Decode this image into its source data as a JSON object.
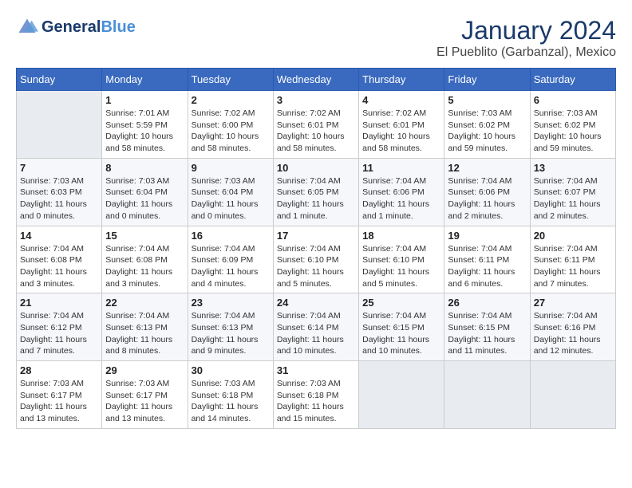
{
  "header": {
    "logo_line1": "General",
    "logo_line2": "Blue",
    "month_title": "January 2024",
    "location": "El Pueblito (Garbanzal), Mexico"
  },
  "calendar": {
    "days_of_week": [
      "Sunday",
      "Monday",
      "Tuesday",
      "Wednesday",
      "Thursday",
      "Friday",
      "Saturday"
    ],
    "weeks": [
      [
        {
          "day": "",
          "empty": true
        },
        {
          "day": "1",
          "sunrise": "7:01 AM",
          "sunset": "5:59 PM",
          "daylight": "10 hours and 58 minutes."
        },
        {
          "day": "2",
          "sunrise": "7:02 AM",
          "sunset": "6:00 PM",
          "daylight": "10 hours and 58 minutes."
        },
        {
          "day": "3",
          "sunrise": "7:02 AM",
          "sunset": "6:01 PM",
          "daylight": "10 hours and 58 minutes."
        },
        {
          "day": "4",
          "sunrise": "7:02 AM",
          "sunset": "6:01 PM",
          "daylight": "10 hours and 58 minutes."
        },
        {
          "day": "5",
          "sunrise": "7:03 AM",
          "sunset": "6:02 PM",
          "daylight": "10 hours and 59 minutes."
        },
        {
          "day": "6",
          "sunrise": "7:03 AM",
          "sunset": "6:02 PM",
          "daylight": "10 hours and 59 minutes."
        }
      ],
      [
        {
          "day": "7",
          "sunrise": "7:03 AM",
          "sunset": "6:03 PM",
          "daylight": "11 hours and 0 minutes."
        },
        {
          "day": "8",
          "sunrise": "7:03 AM",
          "sunset": "6:04 PM",
          "daylight": "11 hours and 0 minutes."
        },
        {
          "day": "9",
          "sunrise": "7:03 AM",
          "sunset": "6:04 PM",
          "daylight": "11 hours and 0 minutes."
        },
        {
          "day": "10",
          "sunrise": "7:04 AM",
          "sunset": "6:05 PM",
          "daylight": "11 hours and 1 minute."
        },
        {
          "day": "11",
          "sunrise": "7:04 AM",
          "sunset": "6:06 PM",
          "daylight": "11 hours and 1 minute."
        },
        {
          "day": "12",
          "sunrise": "7:04 AM",
          "sunset": "6:06 PM",
          "daylight": "11 hours and 2 minutes."
        },
        {
          "day": "13",
          "sunrise": "7:04 AM",
          "sunset": "6:07 PM",
          "daylight": "11 hours and 2 minutes."
        }
      ],
      [
        {
          "day": "14",
          "sunrise": "7:04 AM",
          "sunset": "6:08 PM",
          "daylight": "11 hours and 3 minutes."
        },
        {
          "day": "15",
          "sunrise": "7:04 AM",
          "sunset": "6:08 PM",
          "daylight": "11 hours and 3 minutes."
        },
        {
          "day": "16",
          "sunrise": "7:04 AM",
          "sunset": "6:09 PM",
          "daylight": "11 hours and 4 minutes."
        },
        {
          "day": "17",
          "sunrise": "7:04 AM",
          "sunset": "6:10 PM",
          "daylight": "11 hours and 5 minutes."
        },
        {
          "day": "18",
          "sunrise": "7:04 AM",
          "sunset": "6:10 PM",
          "daylight": "11 hours and 5 minutes."
        },
        {
          "day": "19",
          "sunrise": "7:04 AM",
          "sunset": "6:11 PM",
          "daylight": "11 hours and 6 minutes."
        },
        {
          "day": "20",
          "sunrise": "7:04 AM",
          "sunset": "6:11 PM",
          "daylight": "11 hours and 7 minutes."
        }
      ],
      [
        {
          "day": "21",
          "sunrise": "7:04 AM",
          "sunset": "6:12 PM",
          "daylight": "11 hours and 7 minutes."
        },
        {
          "day": "22",
          "sunrise": "7:04 AM",
          "sunset": "6:13 PM",
          "daylight": "11 hours and 8 minutes."
        },
        {
          "day": "23",
          "sunrise": "7:04 AM",
          "sunset": "6:13 PM",
          "daylight": "11 hours and 9 minutes."
        },
        {
          "day": "24",
          "sunrise": "7:04 AM",
          "sunset": "6:14 PM",
          "daylight": "11 hours and 10 minutes."
        },
        {
          "day": "25",
          "sunrise": "7:04 AM",
          "sunset": "6:15 PM",
          "daylight": "11 hours and 10 minutes."
        },
        {
          "day": "26",
          "sunrise": "7:04 AM",
          "sunset": "6:15 PM",
          "daylight": "11 hours and 11 minutes."
        },
        {
          "day": "27",
          "sunrise": "7:04 AM",
          "sunset": "6:16 PM",
          "daylight": "11 hours and 12 minutes."
        }
      ],
      [
        {
          "day": "28",
          "sunrise": "7:03 AM",
          "sunset": "6:17 PM",
          "daylight": "11 hours and 13 minutes."
        },
        {
          "day": "29",
          "sunrise": "7:03 AM",
          "sunset": "6:17 PM",
          "daylight": "11 hours and 13 minutes."
        },
        {
          "day": "30",
          "sunrise": "7:03 AM",
          "sunset": "6:18 PM",
          "daylight": "11 hours and 14 minutes."
        },
        {
          "day": "31",
          "sunrise": "7:03 AM",
          "sunset": "6:18 PM",
          "daylight": "11 hours and 15 minutes."
        },
        {
          "day": "",
          "empty": true
        },
        {
          "day": "",
          "empty": true
        },
        {
          "day": "",
          "empty": true
        }
      ]
    ]
  },
  "labels": {
    "sunrise": "Sunrise:",
    "sunset": "Sunset:",
    "daylight": "Daylight:"
  }
}
